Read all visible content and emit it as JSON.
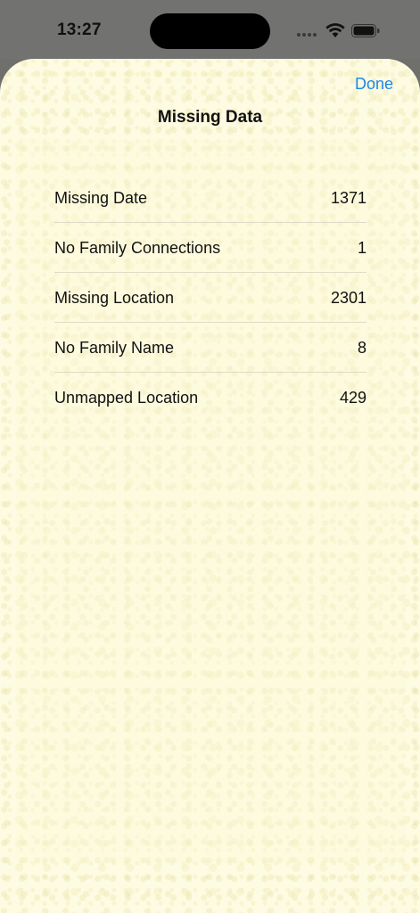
{
  "status_bar": {
    "time": "13:27",
    "icons": [
      "signal-dots-icon",
      "wifi-icon",
      "battery-icon"
    ]
  },
  "sheet": {
    "done_label": "Done",
    "title": "Missing Data",
    "rows": [
      {
        "label": "Missing Date",
        "value": "1371"
      },
      {
        "label": "No Family Connections",
        "value": "1"
      },
      {
        "label": "Missing Location",
        "value": "2301"
      },
      {
        "label": "No Family Name",
        "value": "8"
      },
      {
        "label": "Unmapped Location",
        "value": "429"
      }
    ]
  },
  "colors": {
    "accent": "#1a86e8",
    "sheet_background": "#fdfbe1",
    "dimmed_background": "#727270"
  }
}
